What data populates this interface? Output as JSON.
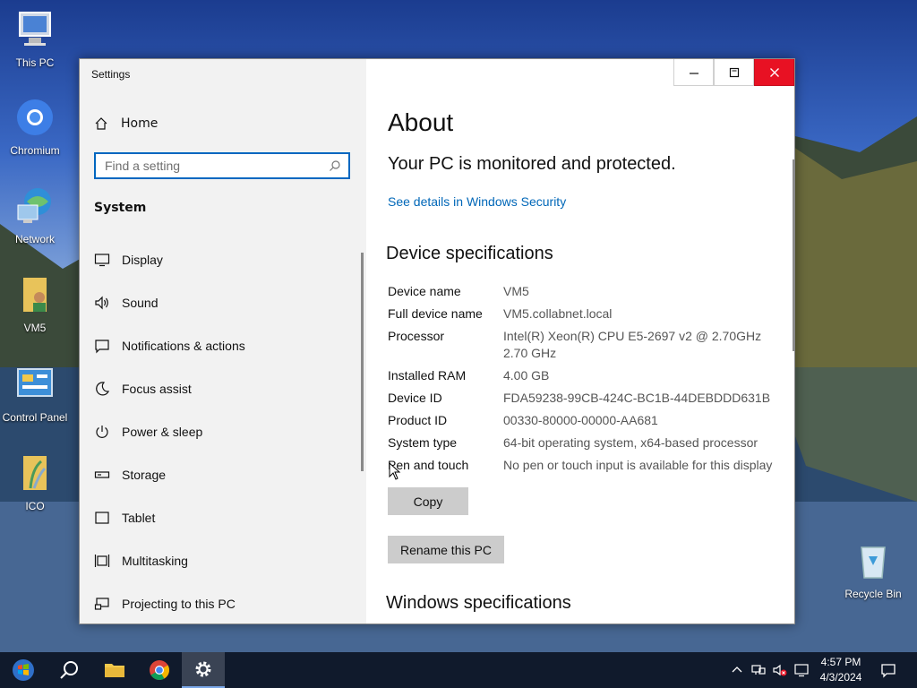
{
  "desktop": {
    "icons": [
      {
        "label": "This PC"
      },
      {
        "label": "Chromium"
      },
      {
        "label": "Network"
      },
      {
        "label": "VM5"
      },
      {
        "label": "Control Panel"
      },
      {
        "label": "ICO"
      },
      {
        "label": "Recycle Bin"
      }
    ]
  },
  "window": {
    "title": "Settings",
    "sidebar": {
      "home_label": "Home",
      "search_placeholder": "Find a setting",
      "section": "System",
      "items": [
        {
          "label": "Display",
          "icon": "monitor-icon"
        },
        {
          "label": "Sound",
          "icon": "speaker-icon"
        },
        {
          "label": "Notifications & actions",
          "icon": "notification-icon"
        },
        {
          "label": "Focus assist",
          "icon": "moon-icon"
        },
        {
          "label": "Power & sleep",
          "icon": "power-icon"
        },
        {
          "label": "Storage",
          "icon": "storage-icon"
        },
        {
          "label": "Tablet",
          "icon": "tablet-icon"
        },
        {
          "label": "Multitasking",
          "icon": "multitasking-icon"
        },
        {
          "label": "Projecting to this PC",
          "icon": "projecting-icon"
        }
      ]
    },
    "content": {
      "title": "About",
      "protection_status": "Your PC is monitored and protected.",
      "security_link": "See details in Windows Security",
      "device_spec_heading": "Device specifications",
      "specs": [
        {
          "key": "Device name",
          "value": "VM5"
        },
        {
          "key": "Full device name",
          "value": "VM5.collabnet.local"
        },
        {
          "key": "Processor",
          "value": "Intel(R) Xeon(R) CPU E5-2697 v2 @ 2.70GHz\n2.70 GHz"
        },
        {
          "key": "Installed RAM",
          "value": "4.00 GB"
        },
        {
          "key": "Device ID",
          "value": "FDA59238-99CB-424C-BC1B-44DEBDDD631B"
        },
        {
          "key": "Product ID",
          "value": "00330-80000-00000-AA681"
        },
        {
          "key": "System type",
          "value": "64-bit operating system, x64-based processor"
        },
        {
          "key": "Pen and touch",
          "value": "No pen or touch input is available for this display"
        }
      ],
      "copy_label": "Copy",
      "rename_label": "Rename this PC",
      "windows_spec_heading": "Windows specifications"
    }
  },
  "taskbar": {
    "time": "4:57 PM",
    "date": "4/3/2024"
  },
  "colors": {
    "accent": "#0067c0",
    "link": "#0067b8",
    "close": "#e81123"
  }
}
